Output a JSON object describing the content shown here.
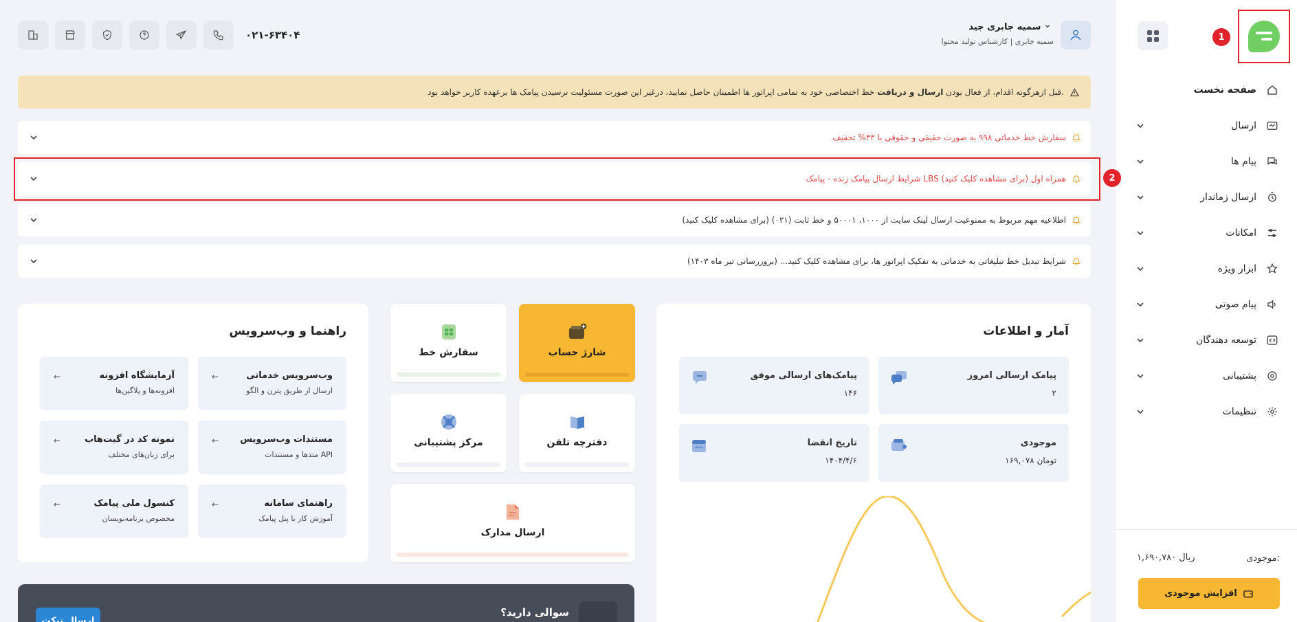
{
  "sidebar": {
    "items": [
      {
        "label": "صفحه نخست",
        "icon": "home-icon"
      },
      {
        "label": "ارسال",
        "icon": "send-message-icon"
      },
      {
        "label": "پیام ها",
        "icon": "chat-icon"
      },
      {
        "label": "ارسال زماندار",
        "icon": "timer-icon"
      },
      {
        "label": "امکانات",
        "icon": "sliders-icon"
      },
      {
        "label": "ابزار ویژه",
        "icon": "star-icon"
      },
      {
        "label": "پیام صوتی",
        "icon": "speaker-icon"
      },
      {
        "label": "توسعه دهندگان",
        "icon": "code-icon"
      },
      {
        "label": "پشتیبانی",
        "icon": "lifebuoy-icon"
      },
      {
        "label": "تنظیمات",
        "icon": "gear-icon"
      }
    ],
    "balance_label": "موجودی:",
    "balance_value": "۱,۶۹۰,۷۸۰ ریال",
    "increase_button": "افزایش موجودی"
  },
  "annotations": {
    "one": "1",
    "two": "2"
  },
  "header": {
    "user_name": "سمیه جابری جید",
    "user_role": "سمیه جابری | کارشناس تولید محتوا",
    "phone": "۰۲۱-۶۳۴۰۴"
  },
  "warning": {
    "text_pre": "قبل ازهرگونه اقدام، از فعال بودن ",
    "text_bold": "ارسال و دریافت",
    "text_post": " خط اختصاصی خود به تمامی اپراتور ها اطمینان حاصل نمایید، درغیر این صورت مسئولیت نرسیدن پیامک ها برعهده کاربر خواهد بود."
  },
  "notices": [
    {
      "text": "سفارش خط خدماتی ۹۹۸ به صورت حقیقی و حقوقی با ۳۳% تخفیف",
      "tone": "red"
    },
    {
      "text": "شرایط ارسال پیامک زنده - پیامک LBS همراه اول (برای مشاهده کلیک کنید)",
      "tone": "red"
    },
    {
      "text": "اطلاعیه مهم مربوط به ممنوعیت ارسال لینک سایت از ۱۰۰۰، ۵۰۰۰۱ و خط ثابت (۰۲۱) (برای مشاهده کلیک کنید)",
      "tone": "dark"
    },
    {
      "text": "شرایط تبدیل خط تبلیغاتی به خدماتی به تفکیک اپراتور ها، برای مشاهده کلیک کنید... (بروزرسانی تیر ماه ۱۴۰۳)",
      "tone": "dark"
    }
  ],
  "stats": {
    "title": "آمار و اطلاعات",
    "items": [
      {
        "label": "پیامک ارسالی امروز",
        "value": "۲"
      },
      {
        "label": "پیامک‌های ارسالی موفق",
        "value": "۱۴۶"
      },
      {
        "label": "موجودی",
        "value": "۱۶۹,۰۷۸ تومان"
      },
      {
        "label": "تاریخ انقضا",
        "value": "۱۴۰۴/۴/۶"
      }
    ]
  },
  "tiles": [
    {
      "label": "شارژ حساب",
      "icon": "wallet-icon"
    },
    {
      "label": "سفارش خط",
      "icon": "sim-card-icon"
    },
    {
      "label": "دفترچه تلفن",
      "icon": "book-icon"
    },
    {
      "label": "مرکز پشتیبانی",
      "icon": "support-icon"
    },
    {
      "label": "ارسال مدارک",
      "icon": "document-icon"
    }
  ],
  "guides": {
    "title": "راهنما و وب‌سرویس",
    "items": [
      {
        "label": "وب‌سرویس خدماتی",
        "sub": "ارسال از طریق پترن و الگو"
      },
      {
        "label": "آزمایشگاه افزونه",
        "sub": "افزونه‌ها و پلاگین‌ها"
      },
      {
        "label": "مستندات وب‌سرویس",
        "sub": "متدها و مستندات API"
      },
      {
        "label": "نمونه کد در گیت‌هاب",
        "sub": "برای زبان‌های مختلف"
      },
      {
        "label": "راهنمای سامانه",
        "sub": "آموزش کار با پنل پیامک"
      },
      {
        "label": "کنسول ملی پیامک",
        "sub": "مخصوص برنامه‌نویسان"
      }
    ],
    "arrow": "←"
  },
  "question": {
    "title": "سوالی دارید؟",
    "button": "ارسال تیکت"
  },
  "colors": {
    "accent": "#f8b733",
    "brand": "#6fcf63",
    "alert": "#e3232b",
    "info_btn": "#2b86d6"
  }
}
